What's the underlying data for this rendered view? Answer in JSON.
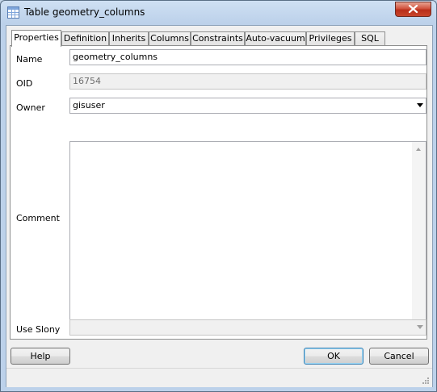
{
  "window": {
    "title": "Table geometry_columns",
    "title_icon": "table-icon",
    "close_icon": "close-icon"
  },
  "tabs": [
    {
      "label": "Properties",
      "active": true
    },
    {
      "label": "Definition"
    },
    {
      "label": "Inherits"
    },
    {
      "label": "Columns"
    },
    {
      "label": "Constraints"
    },
    {
      "label": "Auto-vacuum"
    },
    {
      "label": "Privileges"
    },
    {
      "label": "SQL"
    }
  ],
  "form": {
    "name_label": "Name",
    "name_value": "geometry_columns",
    "oid_label": "OID",
    "oid_value": "16754",
    "owner_label": "Owner",
    "owner_value": "gisuser",
    "comment_label": "Comment",
    "comment_value": "",
    "slony_label": "Use Slony",
    "slony_value": ""
  },
  "buttons": {
    "help": "Help",
    "ok": "OK",
    "cancel": "Cancel"
  },
  "colors": {
    "close_button": "#c8452c",
    "titlebar": "#bcd1ea"
  }
}
